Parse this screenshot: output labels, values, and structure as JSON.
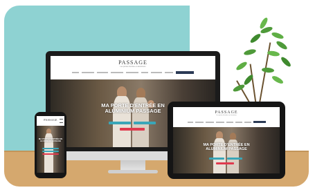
{
  "brand": "PASSAGE",
  "tagline": "Les portes d'entrée en aluminium",
  "hero_title_line1": "MA PORTE D'ENTRÉE EN",
  "hero_title_line2": "ALUMINIUM PASSAGE",
  "colors": {
    "teal_backdrop": "#8ed2d2",
    "floor": "#d5a86e",
    "button_teal": "#3aa6b8",
    "button_red": "#e03a4e",
    "nav_cta": "#2b3a55"
  }
}
